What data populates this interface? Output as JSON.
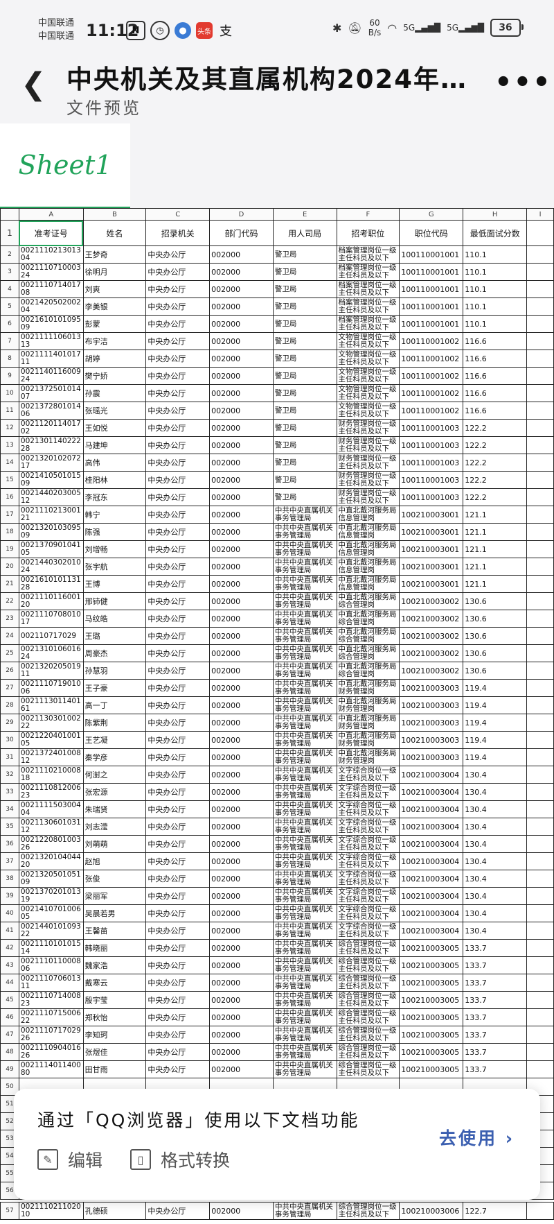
{
  "status_bar": {
    "carrier1": "中国联通",
    "carrier2": "中国联通",
    "time": "11:12",
    "netspeed_value": "60",
    "netspeed_unit": "B/s",
    "battery": "36",
    "signal1": "5G",
    "signal2": "5G",
    "notif_toutiao": "头条"
  },
  "header": {
    "title": "中央机关及其直属机构2024年…",
    "subtitle": "文件预览"
  },
  "sheet": {
    "tab": "Sheet1",
    "col_letters": [
      "A",
      "B",
      "C",
      "D",
      "E",
      "F",
      "G",
      "H",
      "I"
    ],
    "headers": [
      "准考证号",
      "姓名",
      "招录机关",
      "部门代码",
      "用人司局",
      "招考职位",
      "职位代码",
      "最低面试分数"
    ],
    "rows": [
      {
        "n": "2",
        "id": "002111021301304",
        "name": "王梦奇",
        "org": "中央办公厅",
        "dept": "002000",
        "bureau": "警卫局",
        "pos": "档案管理岗位一级主任科员及以下",
        "code": "100110001001",
        "score": "110.1"
      },
      {
        "n": "3",
        "id": "002111071000324",
        "name": "徐明月",
        "org": "中央办公厅",
        "dept": "002000",
        "bureau": "警卫局",
        "pos": "档案管理岗位一级主任科员及以下",
        "code": "100110001001",
        "score": "110.1"
      },
      {
        "n": "4",
        "id": "002111071401708",
        "name": "刘爽",
        "org": "中央办公厅",
        "dept": "002000",
        "bureau": "警卫局",
        "pos": "档案管理岗位一级主任科员及以下",
        "code": "100110001001",
        "score": "110.1"
      },
      {
        "n": "5",
        "id": "002142050200204",
        "name": "李美银",
        "org": "中央办公厅",
        "dept": "002000",
        "bureau": "警卫局",
        "pos": "档案管理岗位一级主任科员及以下",
        "code": "100110001001",
        "score": "110.1"
      },
      {
        "n": "6",
        "id": "002161010109509",
        "name": "彭蒙",
        "org": "中央办公厅",
        "dept": "002000",
        "bureau": "警卫局",
        "pos": "档案管理岗位一级主任科员及以下",
        "code": "100110001001",
        "score": "110.1"
      },
      {
        "n": "7",
        "id": "002111110601313",
        "name": "布宇洁",
        "org": "中央办公厅",
        "dept": "002000",
        "bureau": "警卫局",
        "pos": "文物管理岗位一级主任科员及以下",
        "code": "100110001002",
        "score": "116.6"
      },
      {
        "n": "8",
        "id": "002111140101711",
        "name": "胡婷",
        "org": "中央办公厅",
        "dept": "002000",
        "bureau": "警卫局",
        "pos": "文物管理岗位一级主任科员及以下",
        "code": "100110001002",
        "score": "116.6"
      },
      {
        "n": "9",
        "id": "002114011600924",
        "name": "樊宁娇",
        "org": "中央办公厅",
        "dept": "002000",
        "bureau": "警卫局",
        "pos": "文物管理岗位一级主任科员及以下",
        "code": "100110001002",
        "score": "116.6"
      },
      {
        "n": "10",
        "id": "002137250101407",
        "name": "孙震",
        "org": "中央办公厅",
        "dept": "002000",
        "bureau": "警卫局",
        "pos": "文物管理岗位一级主任科员及以下",
        "code": "100110001002",
        "score": "116.6"
      },
      {
        "n": "11",
        "id": "002137280101406",
        "name": "张瑶光",
        "org": "中央办公厅",
        "dept": "002000",
        "bureau": "警卫局",
        "pos": "文物管理岗位一级主任科员及以下",
        "code": "100110001002",
        "score": "116.6"
      },
      {
        "n": "12",
        "id": "002112011401702",
        "name": "王如悦",
        "org": "中央办公厅",
        "dept": "002000",
        "bureau": "警卫局",
        "pos": "财务管理岗位一级主任科员及以下",
        "code": "100110001003",
        "score": "122.2"
      },
      {
        "n": "13",
        "id": "002130114022228",
        "name": "马建坤",
        "org": "中央办公厅",
        "dept": "002000",
        "bureau": "警卫局",
        "pos": "财务管理岗位一级主任科员及以下",
        "code": "100110001003",
        "score": "122.2"
      },
      {
        "n": "14",
        "id": "002132010207217",
        "name": "高伟",
        "org": "中央办公厅",
        "dept": "002000",
        "bureau": "警卫局",
        "pos": "财务管理岗位一级主任科员及以下",
        "code": "100110001003",
        "score": "122.2"
      },
      {
        "n": "15",
        "id": "002141050101509",
        "name": "桂阳林",
        "org": "中央办公厅",
        "dept": "002000",
        "bureau": "警卫局",
        "pos": "财务管理岗位一级主任科员及以下",
        "code": "100110001003",
        "score": "122.2"
      },
      {
        "n": "16",
        "id": "002144020300512",
        "name": "李冠东",
        "org": "中央办公厅",
        "dept": "002000",
        "bureau": "警卫局",
        "pos": "财务管理岗位一级主任科员及以下",
        "code": "100110001003",
        "score": "122.2"
      },
      {
        "n": "17",
        "id": "002111021300121",
        "name": "韩宁",
        "org": "中央办公厅",
        "dept": "002000",
        "bureau": "中共中央直属机关事务管理局",
        "pos": "中直北戴河服务局信息管理岗",
        "code": "100210003001",
        "score": "121.1"
      },
      {
        "n": "18",
        "id": "002132010309509",
        "name": "陈强",
        "org": "中央办公厅",
        "dept": "002000",
        "bureau": "中共中央直属机关事务管理局",
        "pos": "中直北戴河服务局信息管理岗",
        "code": "100210003001",
        "score": "121.1"
      },
      {
        "n": "19",
        "id": "002137090104105",
        "name": "刘增畅",
        "org": "中央办公厅",
        "dept": "002000",
        "bureau": "中共中央直属机关事务管理局",
        "pos": "中直北戴河服务局信息管理岗",
        "code": "100210003001",
        "score": "121.1"
      },
      {
        "n": "20",
        "id": "002144030201024",
        "name": "张宇航",
        "org": "中央办公厅",
        "dept": "002000",
        "bureau": "中共中央直属机关事务管理局",
        "pos": "中直北戴河服务局信息管理岗",
        "code": "100210003001",
        "score": "121.1"
      },
      {
        "n": "21",
        "id": "002161010113128",
        "name": "王博",
        "org": "中央办公厅",
        "dept": "002000",
        "bureau": "中共中央直属机关事务管理局",
        "pos": "中直北戴河服务局信息管理岗",
        "code": "100210003001",
        "score": "121.1"
      },
      {
        "n": "22",
        "id": "002111011600120",
        "name": "邢铈健",
        "org": "中央办公厅",
        "dept": "002000",
        "bureau": "中共中央直属机关事务管理局",
        "pos": "中直北戴河服务局综合管理岗",
        "code": "100210003002",
        "score": "130.6"
      },
      {
        "n": "23",
        "id": "002111070801017",
        "name": "马纹皓",
        "org": "中央办公厅",
        "dept": "002000",
        "bureau": "中共中央直属机关事务管理局",
        "pos": "中直北戴河服务局综合管理岗",
        "code": "100210003002",
        "score": "130.6"
      },
      {
        "n": "24",
        "id": "002110717029",
        "name": "王璐",
        "org": "中央办公厅",
        "dept": "002000",
        "bureau": "中共中央直属机关事务管理局",
        "pos": "中直北戴河服务局综合管理岗",
        "code": "100210003002",
        "score": "130.6"
      },
      {
        "n": "25",
        "id": "002131010601624",
        "name": "周豪杰",
        "org": "中央办公厅",
        "dept": "002000",
        "bureau": "中共中央直属机关事务管理局",
        "pos": "中直北戴河服务局综合管理岗",
        "code": "100210003002",
        "score": "130.6"
      },
      {
        "n": "26",
        "id": "002132020501911",
        "name": "孙慧羽",
        "org": "中央办公厅",
        "dept": "002000",
        "bureau": "中共中央直属机关事务管理局",
        "pos": "中直北戴河服务局综合管理岗",
        "code": "100210003002",
        "score": "130.6"
      },
      {
        "n": "27",
        "id": "002111071901006",
        "name": "王子豪",
        "org": "中央办公厅",
        "dept": "002000",
        "bureau": "中共中央直属机关事务管理局",
        "pos": "中直北戴河服务局财务管理岗",
        "code": "100210003003",
        "score": "119.4"
      },
      {
        "n": "28",
        "id": "002111301140161",
        "name": "高一丁",
        "org": "中央办公厅",
        "dept": "002000",
        "bureau": "中共中央直属机关事务管理局",
        "pos": "中直北戴河服务局财务管理岗",
        "code": "100210003003",
        "score": "119.4"
      },
      {
        "n": "29",
        "id": "002113030100222",
        "name": "陈紫荆",
        "org": "中央办公厅",
        "dept": "002000",
        "bureau": "中共中央直属机关事务管理局",
        "pos": "中直北戴河服务局财务管理岗",
        "code": "100210003003",
        "score": "119.4"
      },
      {
        "n": "30",
        "id": "002122040100105",
        "name": "王艺凝",
        "org": "中央办公厅",
        "dept": "002000",
        "bureau": "中共中央直属机关事务管理局",
        "pos": "中直北戴河服务局财务管理岗",
        "code": "100210003003",
        "score": "119.4"
      },
      {
        "n": "31",
        "id": "002137240100812",
        "name": "秦学彦",
        "org": "中央办公厅",
        "dept": "002000",
        "bureau": "中共中央直属机关事务管理局",
        "pos": "中直北戴河服务局财务管理岗",
        "code": "100210003003",
        "score": "119.4"
      },
      {
        "n": "32",
        "id": "002111021000818",
        "name": "何澍之",
        "org": "中央办公厅",
        "dept": "002000",
        "bureau": "中共中央直属机关事务管理局",
        "pos": "文字综合岗位一级主任科员及以下",
        "code": "100210003004",
        "score": "130.4"
      },
      {
        "n": "33",
        "id": "002111081200623",
        "name": "张宏源",
        "org": "中央办公厅",
        "dept": "002000",
        "bureau": "中共中央直属机关事务管理局",
        "pos": "文字综合岗位一级主任科员及以下",
        "code": "100210003004",
        "score": "130.4"
      },
      {
        "n": "34",
        "id": "002111150300404",
        "name": "朱瑞贤",
        "org": "中央办公厅",
        "dept": "002000",
        "bureau": "中共中央直属机关事务管理局",
        "pos": "文字综合岗位一级主任科员及以下",
        "code": "100210003004",
        "score": "130.4"
      },
      {
        "n": "35",
        "id": "002113060103112",
        "name": "刘志滢",
        "org": "中央办公厅",
        "dept": "002000",
        "bureau": "中共中央直属机关事务管理局",
        "pos": "文字综合岗位一级主任科员及以下",
        "code": "100210003004",
        "score": "130.4"
      },
      {
        "n": "36",
        "id": "002122080100326",
        "name": "刘萌萌",
        "org": "中央办公厅",
        "dept": "002000",
        "bureau": "中共中央直属机关事务管理局",
        "pos": "文字综合岗位一级主任科员及以下",
        "code": "100210003004",
        "score": "130.4"
      },
      {
        "n": "37",
        "id": "002132010404420",
        "name": "赵旭",
        "org": "中央办公厅",
        "dept": "002000",
        "bureau": "中共中央直属机关事务管理局",
        "pos": "文字综合岗位一级主任科员及以下",
        "code": "100210003004",
        "score": "130.4"
      },
      {
        "n": "38",
        "id": "002132050105109",
        "name": "张俊",
        "org": "中央办公厅",
        "dept": "002000",
        "bureau": "中共中央直属机关事务管理局",
        "pos": "文字综合岗位一级主任科员及以下",
        "code": "100210003004",
        "score": "130.4"
      },
      {
        "n": "39",
        "id": "002137020101319",
        "name": "梁丽军",
        "org": "中央办公厅",
        "dept": "002000",
        "bureau": "中共中央直属机关事务管理局",
        "pos": "文字综合岗位一级主任科员及以下",
        "code": "100210003004",
        "score": "130.4"
      },
      {
        "n": "40",
        "id": "002141070100605",
        "name": "吴晨若男",
        "org": "中央办公厅",
        "dept": "002000",
        "bureau": "中共中央直属机关事务管理局",
        "pos": "文字综合岗位一级主任科员及以下",
        "code": "100210003004",
        "score": "130.4"
      },
      {
        "n": "41",
        "id": "002144010109322",
        "name": "王馨苗",
        "org": "中央办公厅",
        "dept": "002000",
        "bureau": "中共中央直属机关事务管理局",
        "pos": "文字综合岗位一级主任科员及以下",
        "code": "100210003004",
        "score": "130.4"
      },
      {
        "n": "42",
        "id": "002111010101514",
        "name": "韩晓丽",
        "org": "中央办公厅",
        "dept": "002000",
        "bureau": "中共中央直属机关事务管理局",
        "pos": "综合管理岗位一级主任科员及以下",
        "code": "100210003005",
        "score": "133.7"
      },
      {
        "n": "43",
        "id": "002111011000806",
        "name": "魏家浩",
        "org": "中央办公厅",
        "dept": "002000",
        "bureau": "中共中央直属机关事务管理局",
        "pos": "综合管理岗位一级主任科员及以下",
        "code": "100210003005",
        "score": "133.7"
      },
      {
        "n": "44",
        "id": "002111070601311",
        "name": "戴寒云",
        "org": "中央办公厅",
        "dept": "002000",
        "bureau": "中共中央直属机关事务管理局",
        "pos": "综合管理岗位一级主任科员及以下",
        "code": "100210003005",
        "score": "133.7"
      },
      {
        "n": "45",
        "id": "002111071400823",
        "name": "殷宇莹",
        "org": "中央办公厅",
        "dept": "002000",
        "bureau": "中共中央直属机关事务管理局",
        "pos": "综合管理岗位一级主任科员及以下",
        "code": "100210003005",
        "score": "133.7"
      },
      {
        "n": "46",
        "id": "002111071500622",
        "name": "郑秋怡",
        "org": "中央办公厅",
        "dept": "002000",
        "bureau": "中共中央直属机关事务管理局",
        "pos": "综合管理岗位一级主任科员及以下",
        "code": "100210003005",
        "score": "133.7"
      },
      {
        "n": "47",
        "id": "002111071702926",
        "name": "李知珂",
        "org": "中央办公厅",
        "dept": "002000",
        "bureau": "中共中央直属机关事务管理局",
        "pos": "综合管理岗位一级主任科员及以下",
        "code": "100210003005",
        "score": "133.7"
      },
      {
        "n": "48",
        "id": "002111090401626",
        "name": "张煜佳",
        "org": "中央办公厅",
        "dept": "002000",
        "bureau": "中共中央直属机关事务管理局",
        "pos": "综合管理岗位一级主任科员及以下",
        "code": "100210003005",
        "score": "133.7"
      },
      {
        "n": "49",
        "id": "002111401140080",
        "name": "田甘雨",
        "org": "中央办公厅",
        "dept": "002000",
        "bureau": "中共中央直属机关事务管理局",
        "pos": "综合管理岗位一级主任科员及以下",
        "code": "100210003005",
        "score": "133.7"
      }
    ],
    "hidden_row_numbers": [
      "50",
      "51",
      "52",
      "53",
      "54",
      "55",
      "56"
    ],
    "last_row": {
      "n": "57",
      "id": "002111021102010",
      "name": "孔德硕",
      "org": "中央办公厅",
      "dept": "002000",
      "bureau": "中共中央直属机关事务管理局",
      "pos": "综合管理岗位一级主任科员及以下",
      "code": "100210003006",
      "score": "122.7"
    }
  },
  "popup": {
    "title": "通过「QQ浏览器」使用以下文档功能",
    "edit": "编辑",
    "convert": "格式转换",
    "use": "去使用"
  },
  "colors": {
    "accent": "#21a35a",
    "link": "#3b5fb0"
  }
}
